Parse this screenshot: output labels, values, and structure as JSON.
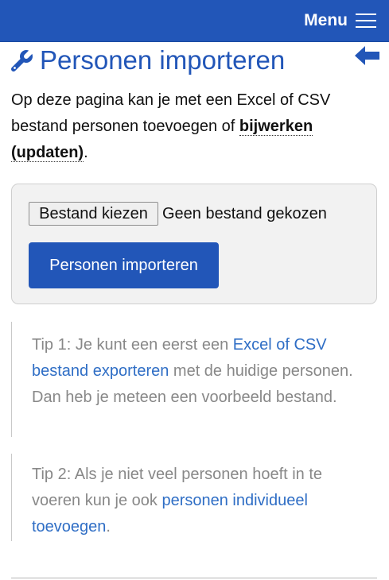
{
  "header": {
    "menu_label": "Menu",
    "accent_color": "#2256b8"
  },
  "page": {
    "title": "Personen importeren",
    "title_icon": "wrench-icon",
    "back_icon": "back-arrow-icon",
    "intro_text": "Op deze pagina kan je met een Excel of CSV bestand personen toevoegen of",
    "intro_bold": "bijwerken (updaten)",
    "intro_end": "."
  },
  "import_form": {
    "file_button_label": "Bestand kiezen",
    "file_status": "Geen bestand gekozen",
    "submit_label": "Personen importeren"
  },
  "tips": {
    "tip1_before": "Tip 1: Je kunt een eerst een",
    "tip1_link": "Excel of CSV bestand exporteren",
    "tip1_after": "met de huidige personen. Dan heb je meteen een voorbeeld bestand.",
    "tip2_before": "Tip 2: Als je niet veel personen hoeft in te voeren kun je ook",
    "tip2_link": "personen individueel toevoegen",
    "tip2_after": "."
  }
}
